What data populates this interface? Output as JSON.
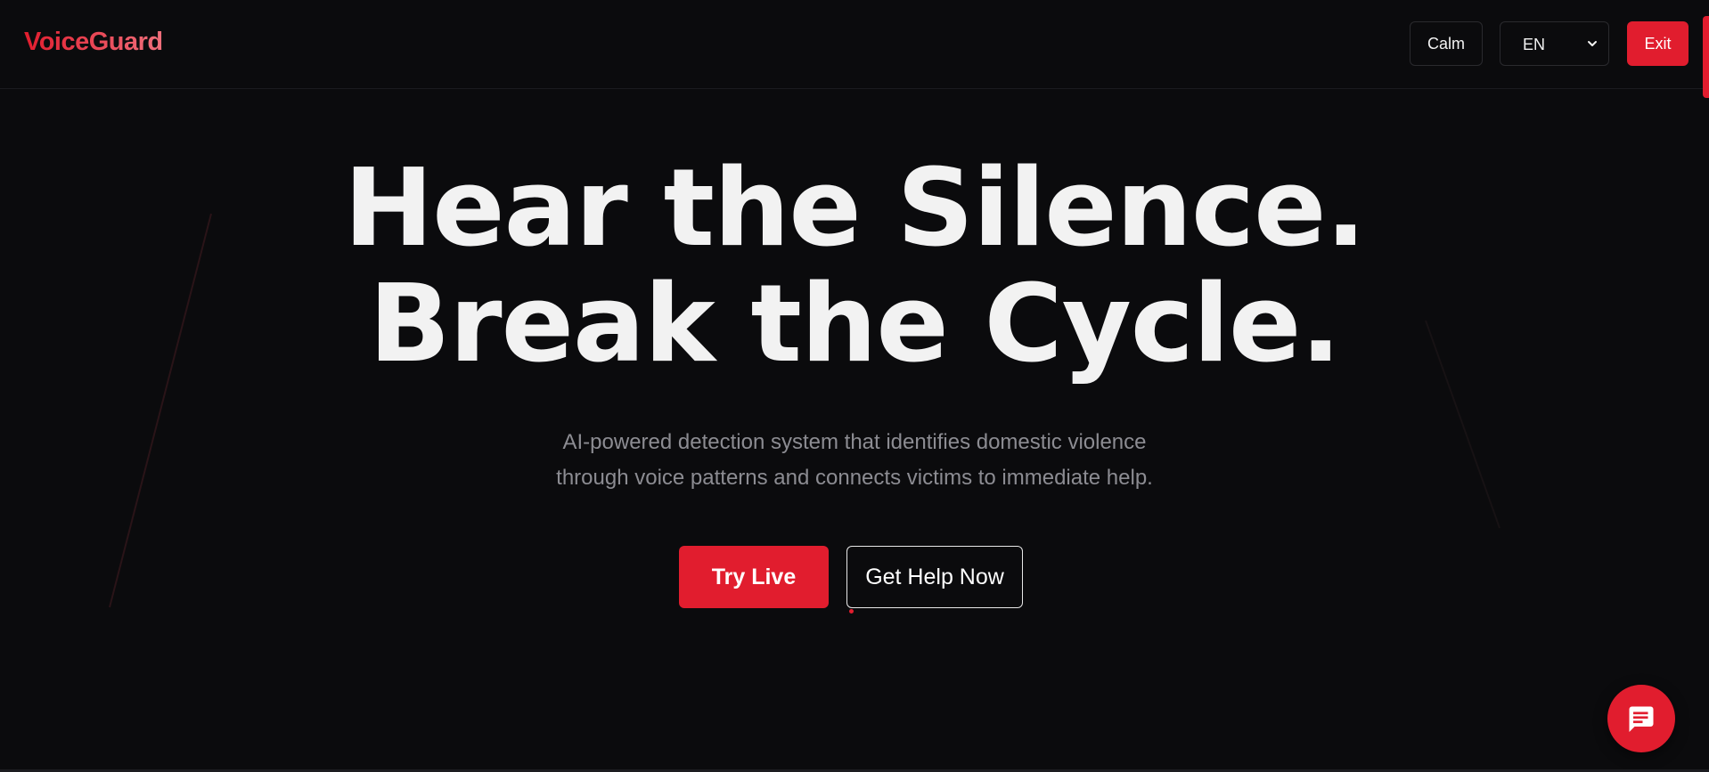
{
  "header": {
    "brand": "VoiceGuard",
    "calm_label": "Calm",
    "language_value": "EN",
    "exit_label": "Exit"
  },
  "hero": {
    "title_line1": "Hear the Silence.",
    "title_line2": "Break the Cycle.",
    "subtitle_line1": "AI-powered detection system that identifies domestic violence",
    "subtitle_line2": "through voice patterns and connects victims to immediate help.",
    "primary_cta": "Try Live",
    "secondary_cta": "Get Help Now"
  },
  "chat": {
    "icon": "chat-bubble-icon"
  },
  "colors": {
    "background": "#0b0b0d",
    "accent": "#e11d2e",
    "text": "#f2f2f2",
    "muted_text": "#8c8c92"
  }
}
